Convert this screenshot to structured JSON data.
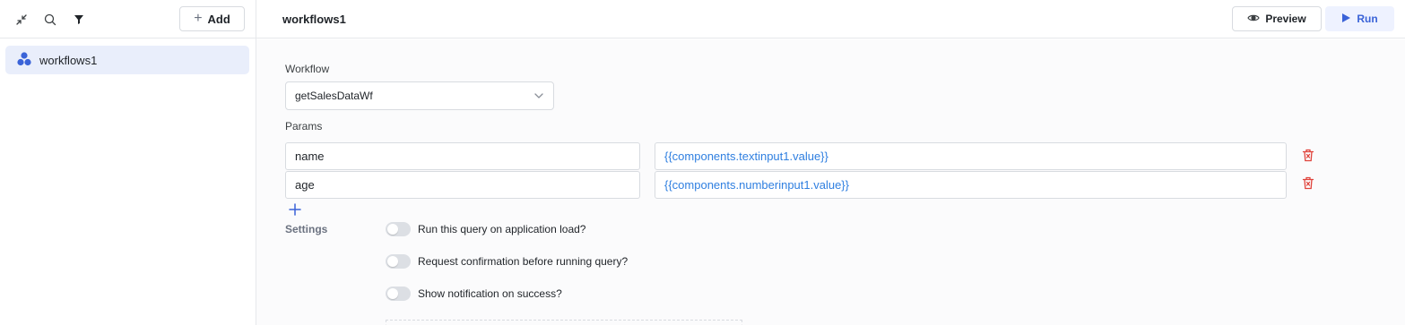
{
  "sidebar": {
    "toolbar": {
      "collapse_icon": "collapse-arrows-icon",
      "search_icon": "search-icon",
      "filter_icon": "filter-icon",
      "add_label": "Add"
    },
    "items": [
      {
        "label": "workflows1",
        "icon": "workflow-hexagons-icon",
        "selected": true
      }
    ]
  },
  "header": {
    "title": "workflows1",
    "preview_label": "Preview",
    "run_label": "Run"
  },
  "form": {
    "workflow_label": "Workflow",
    "workflow_value": "getSalesDataWf",
    "params_label": "Params",
    "params": [
      {
        "name": "name",
        "value": "{{components.textinput1.value}}"
      },
      {
        "name": "age",
        "value": "{{components.numberinput1.value}}"
      }
    ],
    "settings_label": "Settings",
    "settings": [
      {
        "label": "Run this query on application load?",
        "enabled": false
      },
      {
        "label": "Request confirmation before running query?",
        "enabled": false
      },
      {
        "label": "Show notification on success?",
        "enabled": false
      }
    ]
  },
  "colors": {
    "accent": "#3a63d8",
    "selected_bg": "#e9eefb",
    "link_value": "#2f7fe0",
    "delete": "#e0433b"
  }
}
